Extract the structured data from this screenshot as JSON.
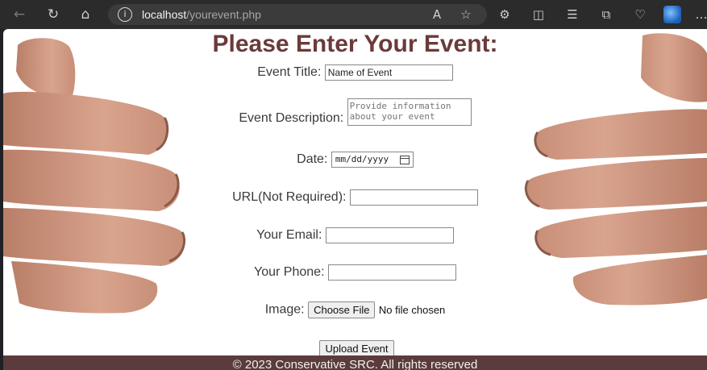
{
  "browser": {
    "url_host": "localhost",
    "url_path": "/yourevent.php",
    "icons": [
      "back-icon",
      "refresh-icon",
      "home-icon",
      "info-icon",
      "read-aloud-icon",
      "favorite-star-icon",
      "extensions-icon",
      "split-screen-icon",
      "favorites-list-icon",
      "collections-icon",
      "browser-essentials-icon",
      "profile-avatar",
      "more-menu-icon"
    ]
  },
  "form": {
    "heading": "Please Enter Your Event:",
    "title_label": "Event Title:",
    "title_value": "Name of Event",
    "description_label": "Event Description:",
    "description_placeholder": "Provide information about your event",
    "date_label": "Date:",
    "date_placeholder": "mm/dd/yyyy",
    "url_label": "URL(Not Required):",
    "url_value": "",
    "email_label": "Your Email:",
    "email_value": "",
    "phone_label": "Your Phone:",
    "phone_value": "",
    "image_label": "Image:",
    "choose_file_label": "Choose File",
    "file_status": "No file chosen",
    "upload_label": "Upload Event"
  },
  "footer": {
    "text": "© 2023 Conservative SRC. All rights reserved"
  },
  "colors": {
    "heading": "#6b3a3a",
    "footer_bg": "#5b3b3b"
  }
}
